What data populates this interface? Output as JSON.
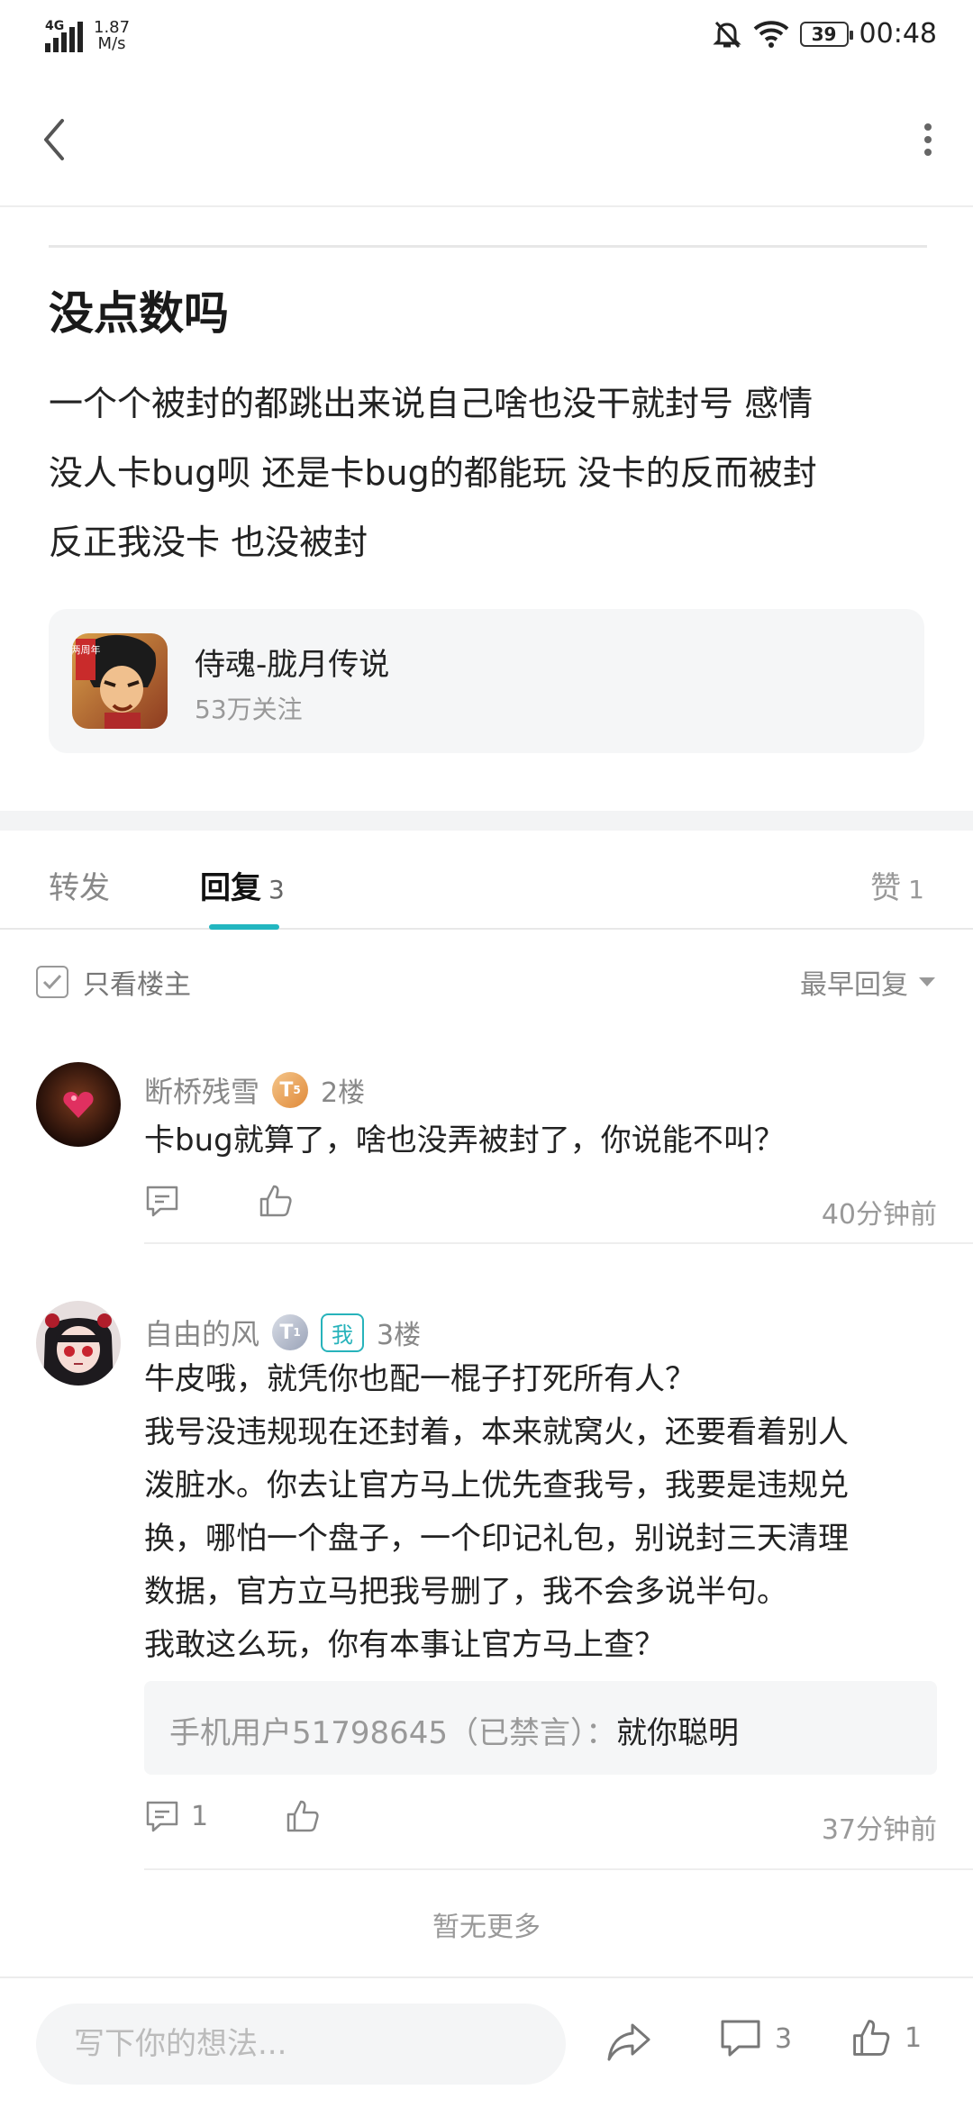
{
  "status_bar": {
    "network": "4G",
    "speed_value": "1.87",
    "speed_unit": "M/s",
    "battery": "39",
    "time": "00:48"
  },
  "post": {
    "title": "没点数吗",
    "body_lines": [
      "一个个被封的都跳出来说自己啥也没干就封号  感情",
      "没人卡bug呗 还是卡bug的都能玩 没卡的反而被封",
      "反正我没卡 也没被封"
    ]
  },
  "forum": {
    "name": "侍魂-胧月传说",
    "followers": "53万关注",
    "icon_text": "两周年"
  },
  "tabs": {
    "forward": "转发",
    "reply": "回复",
    "reply_count": "3",
    "like": "赞",
    "like_count": "1"
  },
  "filter": {
    "only_host": "只看楼主",
    "sort": "最早回复"
  },
  "comments": [
    {
      "user": "断桥残雪",
      "badge": "T",
      "badge_level": "5",
      "floor": "2楼",
      "text": "卡bug就算了，啥也没弄被封了，你说能不叫？",
      "reply_count": "",
      "time": "40分钟前"
    },
    {
      "user": "自由的风",
      "badge": "T",
      "badge_level": "1",
      "me_tag": "我",
      "floor": "3楼",
      "text_lines": [
        "牛皮哦，就凭你也配一棍子打死所有人？",
        "我号没违规现在还封着，本来就窝火，还要看着别人",
        "泼脏水。你去让官方马上优先查我号，我要是违规兑",
        "换，哪怕一个盘子，一个印记礼包，别说封三天清理",
        "数据，官方立马把我号删了，我不会多说半句。",
        "我敢这么玩，你有本事让官方马上查？"
      ],
      "quote_user": "手机用户51798645（已禁言）",
      "quote_sep": "：",
      "quote_text": "就你聪明",
      "reply_count": "1",
      "time": "37分钟前"
    }
  ],
  "no_more": "暂无更多",
  "bottom_bar": {
    "input_placeholder": "写下你的想法...",
    "comment_count": "3",
    "like_count": "1"
  },
  "colors": {
    "accent": "#22b6c0",
    "text": "#222222",
    "muted": "#999999",
    "card_bg": "#f5f6f7"
  }
}
